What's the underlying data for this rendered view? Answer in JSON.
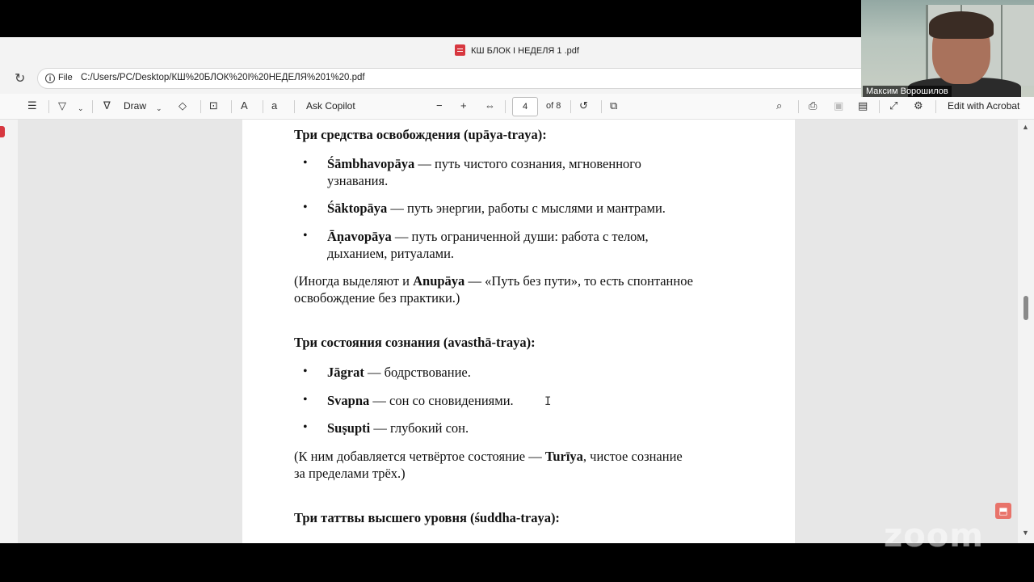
{
  "window": {
    "title": "КШ БЛОК I НЕДЕЛЯ 1 .pdf"
  },
  "address": {
    "file_label": "File",
    "url": "C:/Users/PC/Desktop/КШ%20БЛОК%20I%20НЕДЕЛЯ%201%20.pdf"
  },
  "toolbar": {
    "draw_label": "Draw",
    "ask_copilot_label": "Ask Copilot",
    "current_page": "4",
    "page_total": "of 8",
    "edit_acrobat_label": "Edit with Acrobat"
  },
  "document": {
    "section1": {
      "heading": "Три средства освобождения (upāya-traya):",
      "items": [
        {
          "term": "Śāmbhavopāya",
          "line1": " — путь чистого сознания, мгновенного",
          "line2": "узнавания."
        },
        {
          "term": "Śāktopāya",
          "line1": " — путь энергии, работы с мыслями и мантрами."
        },
        {
          "term": "Āṇavopāya",
          "line1": " — путь ограниченной души: работа с телом,",
          "line2": "дыханием, ритуалами."
        }
      ],
      "note": {
        "pre": "(Иногда выделяют и ",
        "term": "Anupāya",
        "post": " — «Путь без пути», то есть спонтанное",
        "line2": "освобождение без практики.)"
      }
    },
    "section2": {
      "heading": "Три состояния сознания (avasthā-traya):",
      "items": [
        {
          "term": "Jāgrat",
          "text": " — бодрствование."
        },
        {
          "term": "Svapna",
          "text": " — сон со сновидениями."
        },
        {
          "term": "Suṣupti",
          "text": " — глубокий сон."
        }
      ],
      "note": {
        "pre": "(К ним добавляется четвёртое состояние — ",
        "term": "Turīya",
        "post": ", чистое сознание",
        "line2": "за пределами трёх.)"
      }
    },
    "section3": {
      "heading": "Три таттвы высшего уровня (śuddha-traya):"
    }
  },
  "participant": {
    "name": "Максим Ворошилов"
  },
  "watermark": "zoom"
}
